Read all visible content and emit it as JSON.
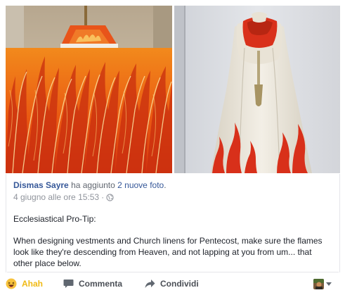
{
  "post": {
    "author": "Dismas Sayre",
    "action_text": "ha aggiunto",
    "action_link": "2 nuove foto",
    "action_end": ".",
    "timestamp": "4 giugno alle ore 15:53",
    "separator": "·",
    "message_title": "Ecclesiastical Pro-Tip:",
    "message_body": "When designing vestments and Church linens for Pentecost, make sure the flames look like they're descending from Heaven, and not lapping at you from um... that other place below."
  },
  "photos": [
    {
      "subject": "orange altar frontal with rising red flames"
    },
    {
      "subject": "white cope with red flames rising from hem, viewed from back"
    }
  ],
  "actions": {
    "reaction_label": "Ahah",
    "comment_label": "Commenta",
    "share_label": "Condividi"
  },
  "colors": {
    "link": "#365899",
    "reaction": "#f0ba15",
    "action_text": "#4b4f56",
    "meta": "#90949c"
  },
  "icons": {
    "reaction": "laughing-emoji-icon",
    "comment": "comment-bubble-icon",
    "share": "share-arrow-icon",
    "privacy": "globe-icon",
    "dropdown": "caret-down-icon"
  }
}
